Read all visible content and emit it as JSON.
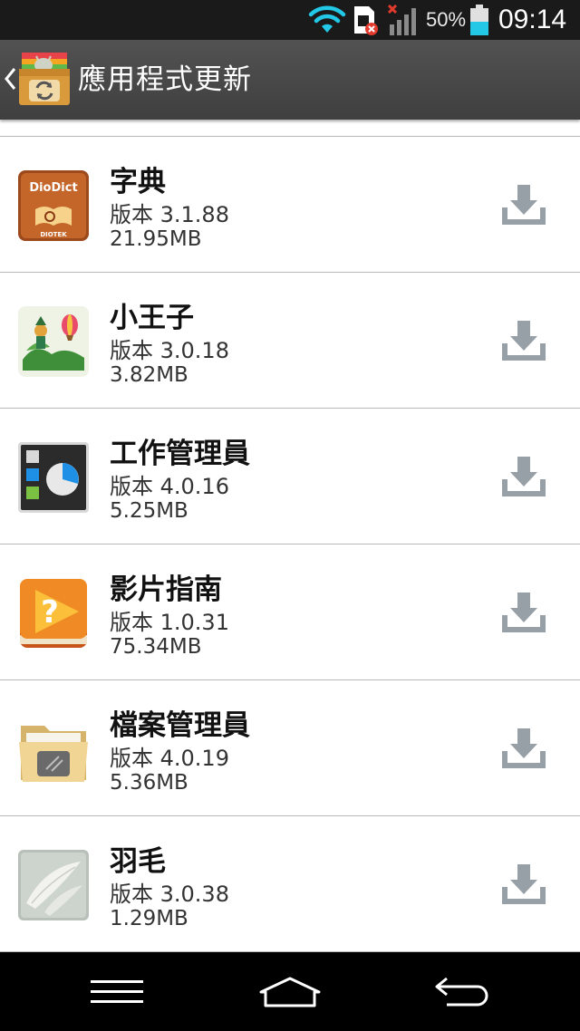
{
  "status_bar": {
    "battery_percent": "50%",
    "time": "09:14",
    "battery_level": 0.5,
    "icons": [
      "wifi-icon",
      "sim-error-icon",
      "signal-no-service-icon",
      "battery-icon"
    ]
  },
  "action_bar": {
    "title": "應用程式更新",
    "icons": [
      "back-chevron-icon",
      "app-updater-logo-icon"
    ]
  },
  "updates": [
    {
      "name": "字典",
      "version": "版本 3.1.88",
      "size": "21.95MB",
      "icon": "diodict-icon",
      "icon_text": "DioDict",
      "icon_subtext": "DIOTEK"
    },
    {
      "name": "小王子",
      "version": "版本 3.0.18",
      "size": "3.82MB",
      "icon": "little-prince-icon"
    },
    {
      "name": "工作管理員",
      "version": "版本 4.0.16",
      "size": "5.25MB",
      "icon": "task-manager-icon"
    },
    {
      "name": "影片指南",
      "version": "版本 1.0.31",
      "size": "75.34MB",
      "icon": "video-guide-icon"
    },
    {
      "name": "檔案管理員",
      "version": "版本 4.0.19",
      "size": "5.36MB",
      "icon": "file-manager-icon"
    },
    {
      "name": "羽毛",
      "version": "版本 3.0.38",
      "size": "1.29MB",
      "icon": "feather-icon"
    }
  ],
  "nav_bar": {
    "buttons": [
      "menu-icon",
      "home-icon",
      "back-icon"
    ]
  },
  "colors": {
    "status_bar": "#1a1a1a",
    "action_bar": "#4a4a4a",
    "wifi": "#22c8e6",
    "battery_fill": "#22c8e6",
    "download_icon": "#97a0a6",
    "divider": "#b8b8b8",
    "nav_bar": "#000000"
  }
}
